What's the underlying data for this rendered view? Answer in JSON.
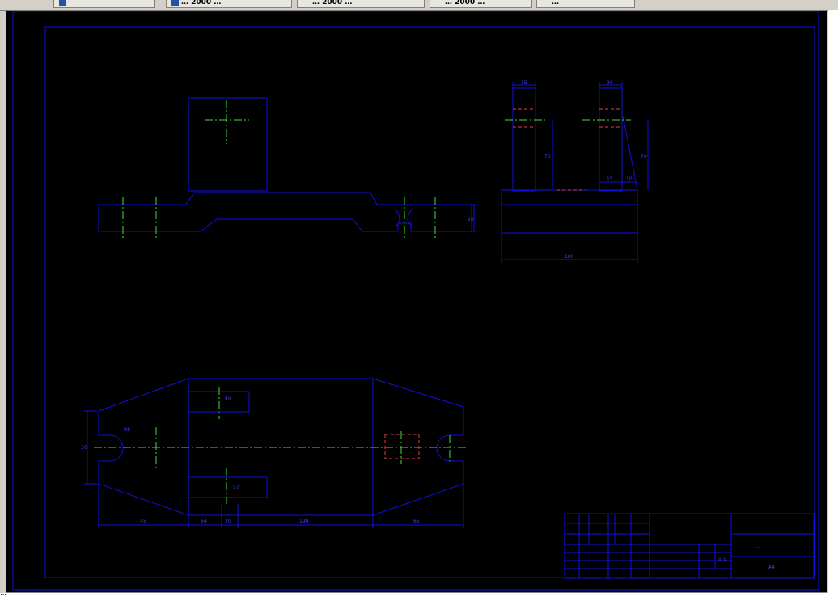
{
  "taskbar": {
    "buttons": [
      {
        "label": ""
      },
      {
        "label": "… 2000 …"
      },
      {
        "label": "… 2000 …"
      },
      {
        "label": "… 2000 …"
      },
      {
        "label": "…"
      }
    ]
  },
  "drawing": {
    "dimensions": {
      "top_width_left": "15",
      "top_width_right": "20",
      "height_left": "70",
      "height_right": "70",
      "gap_left": "15",
      "gap_right": "10",
      "side_total_width": "100",
      "side_height": "20",
      "plan_height": "30",
      "radius": "R8",
      "slot_top": "45",
      "slot_bottom": "57",
      "dim_45": "45",
      "dim_64": "64",
      "dim_20": "20",
      "dim_190": "190",
      "dim_65": "65"
    },
    "title_block": {
      "title": "…",
      "sheet_size": "A4",
      "scale": "1:1"
    }
  },
  "status": {
    "text": "…"
  },
  "colors": {
    "line": "#1010e0",
    "center": "#40e040",
    "hidden": "#e04040",
    "background": "#000000"
  }
}
